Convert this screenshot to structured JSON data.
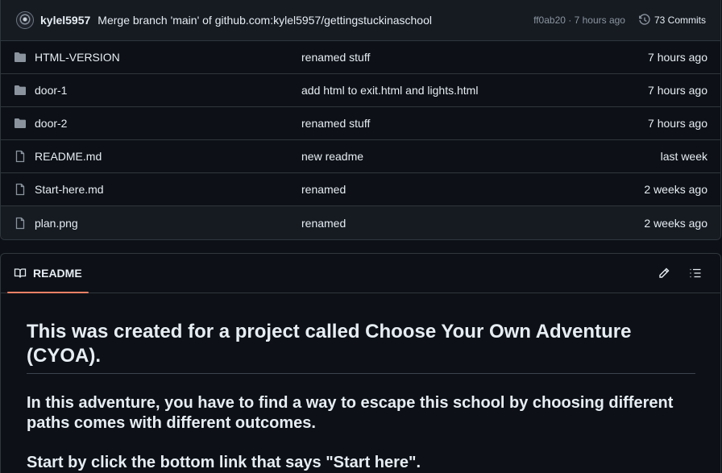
{
  "commit": {
    "author": "kylel5957",
    "message": "Merge branch 'main' of github.com:kylel5957/gettingstuckinaschool",
    "meta": "ff0ab20 · 7 hours ago",
    "commits_label": "73 Commits"
  },
  "files": [
    {
      "type": "folder",
      "name": "HTML-VERSION",
      "message": "renamed stuff",
      "time": "7 hours ago"
    },
    {
      "type": "folder",
      "name": "door-1",
      "message": "add html to exit.html and lights.html",
      "time": "7 hours ago"
    },
    {
      "type": "folder",
      "name": "door-2",
      "message": "renamed stuff",
      "time": "7 hours ago"
    },
    {
      "type": "file",
      "name": "README.md",
      "message": "new readme",
      "time": "last week"
    },
    {
      "type": "file",
      "name": "Start-here.md",
      "message": "renamed",
      "time": "2 weeks ago"
    },
    {
      "type": "file",
      "name": "plan.png",
      "message": "renamed",
      "time": "2 weeks ago"
    }
  ],
  "readme": {
    "tab_label": "README",
    "heading1": "This was created for a project called Choose Your Own Adventure (CYOA).",
    "heading2": "In this adventure, you have to find a way to escape this school by choosing different paths comes with different outcomes.",
    "heading3": "Start by click the bottom link that says \"Start here\"."
  },
  "icons": {
    "folder": "folder-icon",
    "file": "file-icon",
    "history": "history-icon",
    "book": "book-icon",
    "edit": "pencil-icon",
    "outline": "list-icon"
  },
  "colors": {
    "background": "#0d1117",
    "border": "#30363d",
    "muted": "#8b949e",
    "tab_accent": "#f78166"
  }
}
